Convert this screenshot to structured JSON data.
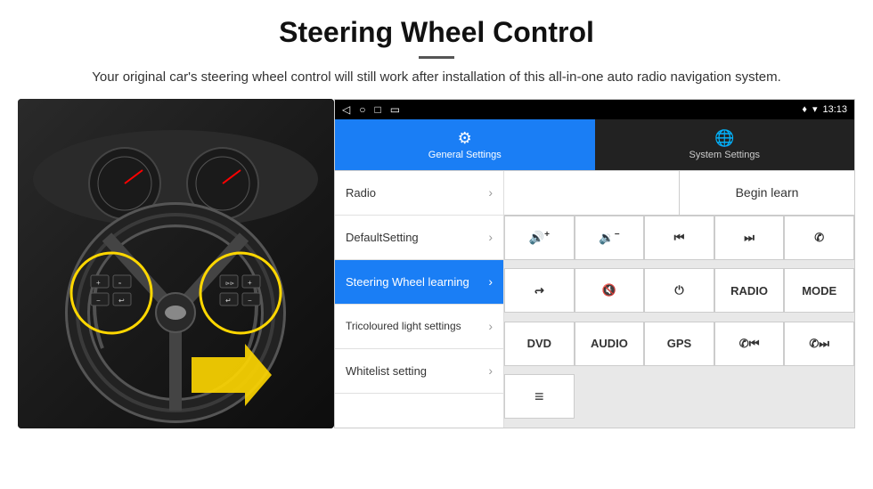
{
  "header": {
    "title": "Steering Wheel Control",
    "description": "Your original car's steering wheel control will still work after installation of this all-in-one auto radio navigation system."
  },
  "status_bar": {
    "back_icon": "◁",
    "home_icon": "○",
    "square_icon": "□",
    "cast_icon": "▭",
    "signal_icon": "▾",
    "wifi_icon": "▾",
    "time": "13:13"
  },
  "tabs": [
    {
      "id": "general",
      "label": "General Settings",
      "icon": "⚙",
      "active": true
    },
    {
      "id": "system",
      "label": "System Settings",
      "icon": "🌐",
      "active": false
    }
  ],
  "menu_items": [
    {
      "id": "radio",
      "label": "Radio",
      "active": false
    },
    {
      "id": "default",
      "label": "DefaultSetting",
      "active": false
    },
    {
      "id": "steering",
      "label": "Steering Wheel learning",
      "active": true
    },
    {
      "id": "tricoloured",
      "label": "Tricoloured light settings",
      "active": false
    },
    {
      "id": "whitelist",
      "label": "Whitelist setting",
      "active": false
    }
  ],
  "control_panel": {
    "begin_learn_label": "Begin learn",
    "buttons": [
      {
        "id": "vol-up",
        "label": "",
        "icon": "🔊+",
        "unicode": "◀+"
      },
      {
        "id": "vol-down",
        "label": "",
        "icon": "🔉-",
        "unicode": "◀−"
      },
      {
        "id": "prev-track",
        "label": "",
        "icon": "⏮",
        "unicode": "⏮"
      },
      {
        "id": "next-track",
        "label": "",
        "icon": "⏭",
        "unicode": "⏭"
      },
      {
        "id": "phone",
        "label": "",
        "icon": "📞",
        "unicode": "✆"
      },
      {
        "id": "hangup",
        "label": "",
        "icon": "↩",
        "unicode": "↩"
      },
      {
        "id": "mute",
        "label": "",
        "icon": "🔇",
        "unicode": "◀✕"
      },
      {
        "id": "power",
        "label": "",
        "icon": "⏻",
        "unicode": "⏻"
      },
      {
        "id": "radio-btn",
        "label": "RADIO",
        "icon": "",
        "unicode": "RADIO"
      },
      {
        "id": "mode",
        "label": "MODE",
        "icon": "",
        "unicode": "MODE"
      },
      {
        "id": "dvd",
        "label": "DVD",
        "icon": "",
        "unicode": "DVD"
      },
      {
        "id": "audio",
        "label": "AUDIO",
        "icon": "",
        "unicode": "AUDIO"
      },
      {
        "id": "gps",
        "label": "GPS",
        "icon": "",
        "unicode": "GPS"
      },
      {
        "id": "phone-prev",
        "label": "",
        "icon": "📞⏮",
        "unicode": "✆⏮"
      },
      {
        "id": "phone-next",
        "label": "",
        "icon": "📞⏭",
        "unicode": "✆⏭"
      },
      {
        "id": "list-icon",
        "label": "",
        "icon": "≡",
        "unicode": "≡"
      }
    ]
  }
}
